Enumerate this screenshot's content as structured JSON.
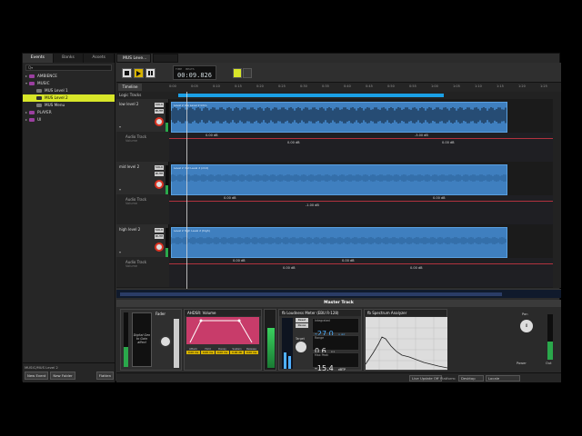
{
  "left_panel": {
    "tabs": [
      "Events",
      "Banks",
      "Assets"
    ],
    "search_placeholder": "Q▾",
    "tree": [
      {
        "label": "AMBIENCE",
        "level": 0,
        "color": "#9b3fa0",
        "expanded": false
      },
      {
        "label": "MUSIC",
        "level": 0,
        "color": "#9b3fa0",
        "expanded": true
      },
      {
        "label": "MUS Level 1",
        "level": 1,
        "color": "#777777"
      },
      {
        "label": "MUS Level 2",
        "level": 1,
        "color": "#777777",
        "selected": true
      },
      {
        "label": "MUS Menu",
        "level": 1,
        "color": "#777777"
      },
      {
        "label": "PLAYER",
        "level": 0,
        "color": "#9b3fa0",
        "expanded": false
      },
      {
        "label": "UI",
        "level": 0,
        "color": "#9b3fa0",
        "expanded": false
      }
    ],
    "footer_path": "MUSIC/MUS Level 2",
    "new_event": "New Event",
    "new_folder": "New Folder",
    "flatten": "Flatten"
  },
  "editor": {
    "doc_tab": "MUS Leve...",
    "time_label": "TIME",
    "beats_label": "BEATS",
    "time_value": "00:09.826",
    "timeline_tab": "Timeline",
    "logic_tracks": "Logic Tracks",
    "ruler": [
      "0:00",
      "0:05",
      "0:10",
      "0:15",
      "0:20",
      "0:25",
      "0:30",
      "0:35",
      "0:40",
      "0:45",
      "0:50",
      "0:55",
      "1:00",
      "1:05",
      "1:10",
      "1:15",
      "1:20",
      "1:25"
    ],
    "tracks": [
      {
        "name": "low level 2",
        "instrument": "Level 2 low Level 2 Intro",
        "sub": "Audio Track",
        "sub2": "Volume",
        "db": [
          "0.00 dB",
          "0.00 dB",
          "-3.00 dB",
          "0.00 dB"
        ]
      },
      {
        "name": "mid level 2",
        "instrument": "Level 2 mid Level 2 (mid)",
        "sub": "Audio Track",
        "sub2": "Volume",
        "db": [
          "0.00 dB",
          "-1.00 dB",
          "0.00 dB"
        ]
      },
      {
        "name": "high level 2",
        "instrument": "Level 2 high Level 2 (high)",
        "sub": "Audio Track",
        "sub2": "Volume",
        "db": [
          "0.00 dB",
          "0.00 dB",
          "0.00 dB",
          "0.00 dB"
        ]
      }
    ],
    "solo": "SOLO",
    "mute": "MUTE"
  },
  "master": {
    "title": "Master Track",
    "fader_label": "Fader",
    "digital_note": "Digital Gen to Gain affect",
    "volume_panel": "AHDSR: Volume",
    "loudness_panel": "fb Loudness Meter (EBU R-128)",
    "integrated_label": "Integrated",
    "integrated_value": "-27.0",
    "integrated_unit": "LUFS",
    "range_label": "Range",
    "range_value": "0.6",
    "range_unit": "LU",
    "maxpeak_label": "Max Peak",
    "maxpeak_value": "-15.4",
    "maxpeak_unit": "dBTP",
    "reset": "Reset",
    "pause": "Pause",
    "target": "Target",
    "spectrum_panel": "fb Spectrum Analyzer",
    "pan_label": "Pan",
    "pan_value": "0",
    "power_label": "Power",
    "out_label": "Out",
    "ahdsr_labels": [
      "Attack",
      "Hold",
      "Decay",
      "Sustain",
      "Release"
    ],
    "ahdsr_values": [
      "0.00 ms",
      "0.00 ms",
      "0.00 ms",
      "0.00 dB",
      "0.00 ms"
    ]
  },
  "status": {
    "live_update": "Live Update Off",
    "platform_label": "Platform:",
    "platform": "Desktop",
    "locale": "Locale"
  },
  "colors": {
    "selection": "#d8e629",
    "instrument": "#3f7fbf",
    "automation": "#b2323e",
    "folder": "#9b3fa0"
  }
}
